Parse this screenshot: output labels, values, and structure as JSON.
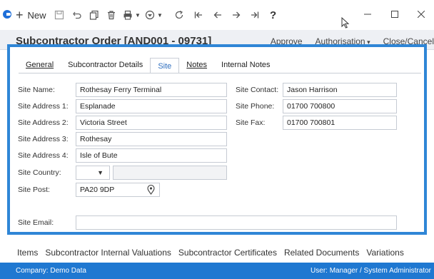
{
  "toolbar": {
    "new_label": "New",
    "help_label": "?"
  },
  "titlebar": {
    "title": "Subcontractor Order [AND001 - 09731]",
    "approve": "Approve",
    "authorisation": "Authorisation",
    "close_cancel": "Close/Cancel"
  },
  "tabs": [
    {
      "label": "General"
    },
    {
      "label": "Subcontractor Details"
    },
    {
      "label": "Site"
    },
    {
      "label": "Notes"
    },
    {
      "label": "Internal Notes"
    }
  ],
  "site": {
    "name_label": "Site Name:",
    "name": "Rothesay Ferry Terminal",
    "addr1_label": "Site Address 1:",
    "addr1": "Esplanade",
    "addr2_label": "Site Address 2:",
    "addr2": "Victoria Street",
    "addr3_label": "Site Address 3:",
    "addr3": "Rothesay",
    "addr4_label": "Site Address 4:",
    "addr4": "Isle of Bute",
    "country_label": "Site Country:",
    "country": "",
    "post_label": "Site Post:",
    "post": "PA20 9DP",
    "email_label": "Site Email:",
    "email": "",
    "contact_label": "Site Contact:",
    "contact": "Jason Harrison",
    "phone_label": "Site Phone:",
    "phone": "01700 700800",
    "fax_label": "Site Fax:",
    "fax": "01700 700801"
  },
  "bottom_nav": [
    "Items",
    "Subcontractor Internal Valuations",
    "Subcontractor Certificates",
    "Related Documents",
    "Variations"
  ],
  "status": {
    "company": "Company: Demo Data",
    "user": "User: Manager / System Administrator"
  },
  "colors": {
    "accent": "#1f78d1",
    "frame": "#2f86d6",
    "active_tab_text": "#2f6fbf"
  }
}
